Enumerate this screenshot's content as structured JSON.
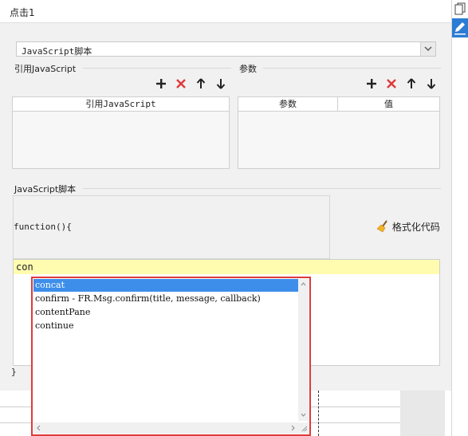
{
  "title": "点击1",
  "script_type": {
    "selected": "JavaScript脚本"
  },
  "imports": {
    "section_label": "引用JavaScript",
    "column": "引用JavaScript"
  },
  "params": {
    "section_label": "参数",
    "columns": [
      "参数",
      "值"
    ]
  },
  "script": {
    "section_label": "JavaScript脚本",
    "function_header": "function(){",
    "format_label": "格式化代码",
    "editor_text": "con",
    "closing": "}"
  },
  "autocomplete": {
    "items": [
      "concat",
      "confirm - FR.Msg.confirm(title, message, callback)",
      "contentPane",
      "continue"
    ],
    "selected_index": 0
  },
  "colors": {
    "selection": "#3d8eea",
    "highlight_line": "#fffcb0",
    "popup_border": "#e03a3a",
    "delete": "#e03a3a"
  }
}
